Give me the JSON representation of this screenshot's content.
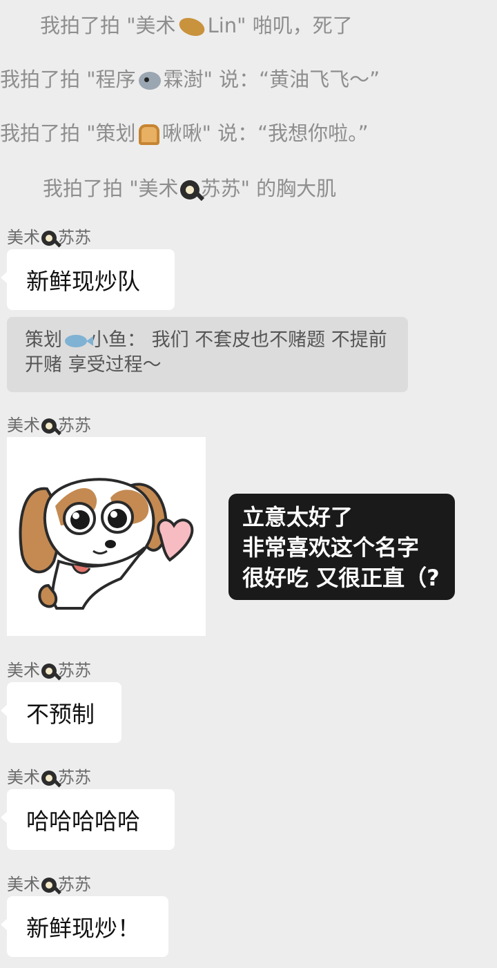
{
  "system_messages": [
    {
      "prefix": "我拍了拍 \"美术",
      "emoji": "potato-emoji",
      "suffix": "Lin\" 啪叽，死了"
    },
    {
      "prefix": "我拍了拍 \"程序",
      "emoji": "bird-emoji",
      "suffix": "霖澍\" 说：“黄油飞飞～”"
    },
    {
      "prefix": "我拍了拍 \"策划",
      "emoji": "bread-emoji",
      "suffix": "啾啾\" 说：“我想你啦。”"
    },
    {
      "prefix": "我拍了拍 \"美术",
      "emoji": "frying-pan-emoji",
      "suffix": "苏苏\" 的胸大肌"
    }
  ],
  "sender": {
    "prefix": "美术",
    "emoji": "frying-pan-emoji",
    "suffix": "苏苏"
  },
  "messages": [
    {
      "type": "text",
      "text": "新鲜现炒队"
    },
    {
      "type": "quote",
      "author_prefix": "策划",
      "author_emoji": "fish-emoji",
      "author_suffix": "小鱼：",
      "text": "我们 不套皮也不赌题 不提前开赌 享受过程～"
    },
    {
      "type": "sticker",
      "description_icon": "puppy-heart-sticker",
      "overlay_lines": [
        "立意太好了",
        "非常喜欢这个名字",
        "很好吃 又很正直（?"
      ]
    },
    {
      "type": "text",
      "text": "不预制"
    },
    {
      "type": "text",
      "text": "哈哈哈哈哈"
    },
    {
      "type": "text",
      "text": "新鲜现炒！"
    }
  ],
  "colors": {
    "background": "#ededed",
    "bubble": "#ffffff",
    "quote_background": "#dcdcdc",
    "overlay_background": "#1a1a1a"
  }
}
